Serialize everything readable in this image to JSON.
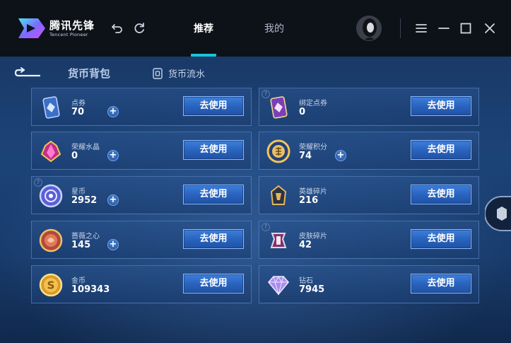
{
  "app": {
    "logo_cn": "腾讯先锋",
    "logo_en": "Tencent Pioneer",
    "tabs": [
      {
        "label": "推荐",
        "active": true
      },
      {
        "label": "我的",
        "active": false
      }
    ],
    "accent_color": "#18c4d8"
  },
  "page": {
    "title": "货币背包",
    "flow_link": "货币流水",
    "use_label": "去使用",
    "plus_label": "+",
    "help_label": "?"
  },
  "currencies": [
    {
      "name": "点券",
      "value": "70",
      "icon": "coupon-card-icon"
    },
    {
      "name": "绑定点券",
      "value": "0",
      "icon": "bound-coupon-card-icon"
    },
    {
      "name": "荣耀水晶",
      "value": "0",
      "icon": "glory-crystal-icon"
    },
    {
      "name": "荣耀积分",
      "value": "74",
      "icon": "glory-points-icon"
    },
    {
      "name": "星币",
      "value": "2952",
      "icon": "star-coin-icon"
    },
    {
      "name": "英雄碎片",
      "value": "216",
      "icon": "hero-fragment-icon"
    },
    {
      "name": "蔷薇之心",
      "value": "145",
      "icon": "rose-heart-icon"
    },
    {
      "name": "皮肤碎片",
      "value": "42",
      "icon": "skin-fragment-icon"
    },
    {
      "name": "金币",
      "value": "109343",
      "icon": "gold-coin-icon"
    },
    {
      "name": "钻石",
      "value": "7945",
      "icon": "diamond-icon"
    }
  ]
}
